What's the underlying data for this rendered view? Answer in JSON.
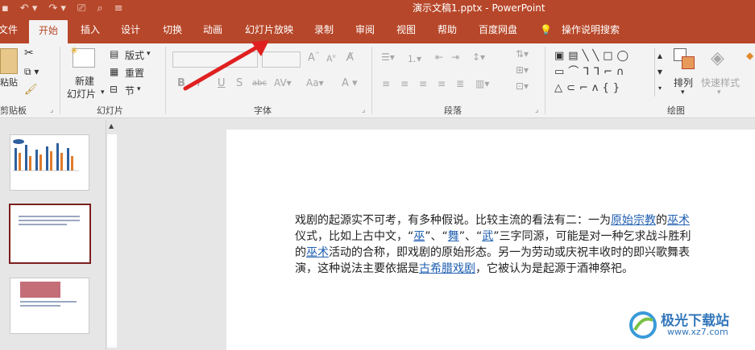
{
  "window": {
    "title": "演示文稿1.pptx - PowerPoint"
  },
  "tabs": [
    {
      "label": "文件",
      "active": false
    },
    {
      "label": "开始",
      "active": true
    },
    {
      "label": "插入",
      "active": false
    },
    {
      "label": "设计",
      "active": false
    },
    {
      "label": "切换",
      "active": false
    },
    {
      "label": "动画",
      "active": false
    },
    {
      "label": "幻灯片放映",
      "active": false
    },
    {
      "label": "录制",
      "active": false
    },
    {
      "label": "审阅",
      "active": false
    },
    {
      "label": "视图",
      "active": false
    },
    {
      "label": "帮助",
      "active": false
    },
    {
      "label": "百度网盘",
      "active": false
    }
  ],
  "tell_me": "操作说明搜索",
  "ribbon": {
    "clipboard": {
      "paste": "粘贴",
      "group": "剪贴板"
    },
    "slides": {
      "new_slide_1": "新建",
      "new_slide_2": "幻灯片",
      "layout": "版式",
      "reset": "重置",
      "section": "节",
      "group": "幻灯片"
    },
    "font": {
      "group": "字体",
      "bold": "B",
      "italic": "I",
      "underline": "U",
      "shadow": "S",
      "strike": "abc"
    },
    "paragraph": {
      "group": "段落"
    },
    "drawing": {
      "arrange": "排列",
      "quick_styles": "快速样式",
      "group": "绘图"
    }
  },
  "slide": {
    "segments": [
      {
        "t": "戏剧的起源实不可考，有多种假说。比较主流的看法有二：一为",
        "link": false
      },
      {
        "t": "原始宗教",
        "link": true
      },
      {
        "t": "的",
        "link": false
      },
      {
        "t": "巫术",
        "link": true
      },
      {
        "t": "仪式，比如上古中文，“",
        "link": false
      },
      {
        "t": "巫",
        "link": true
      },
      {
        "t": "”、“",
        "link": false
      },
      {
        "t": "舞",
        "link": true
      },
      {
        "t": "”、“",
        "link": false
      },
      {
        "t": "武",
        "link": true
      },
      {
        "t": "”三字同源，可能是对一种乞求战斗胜利的",
        "link": false
      },
      {
        "t": "巫术",
        "link": true
      },
      {
        "t": "活动的合称，即戏剧的原始形态。另一为劳动或庆祝丰收时的即兴歌舞表演，这种说法主要依据是",
        "link": false
      },
      {
        "t": "古希腊戏剧",
        "link": true
      },
      {
        "t": "，它被认为是起源于酒神祭祀。",
        "link": false
      }
    ]
  },
  "watermark": {
    "name": "极光下载站",
    "url": "www.xz7.com"
  },
  "colors": {
    "accent": "#b7472a",
    "arrow": "#e02020",
    "link": "#1f5fb0",
    "selected_thumb": "#7b1f1f"
  }
}
